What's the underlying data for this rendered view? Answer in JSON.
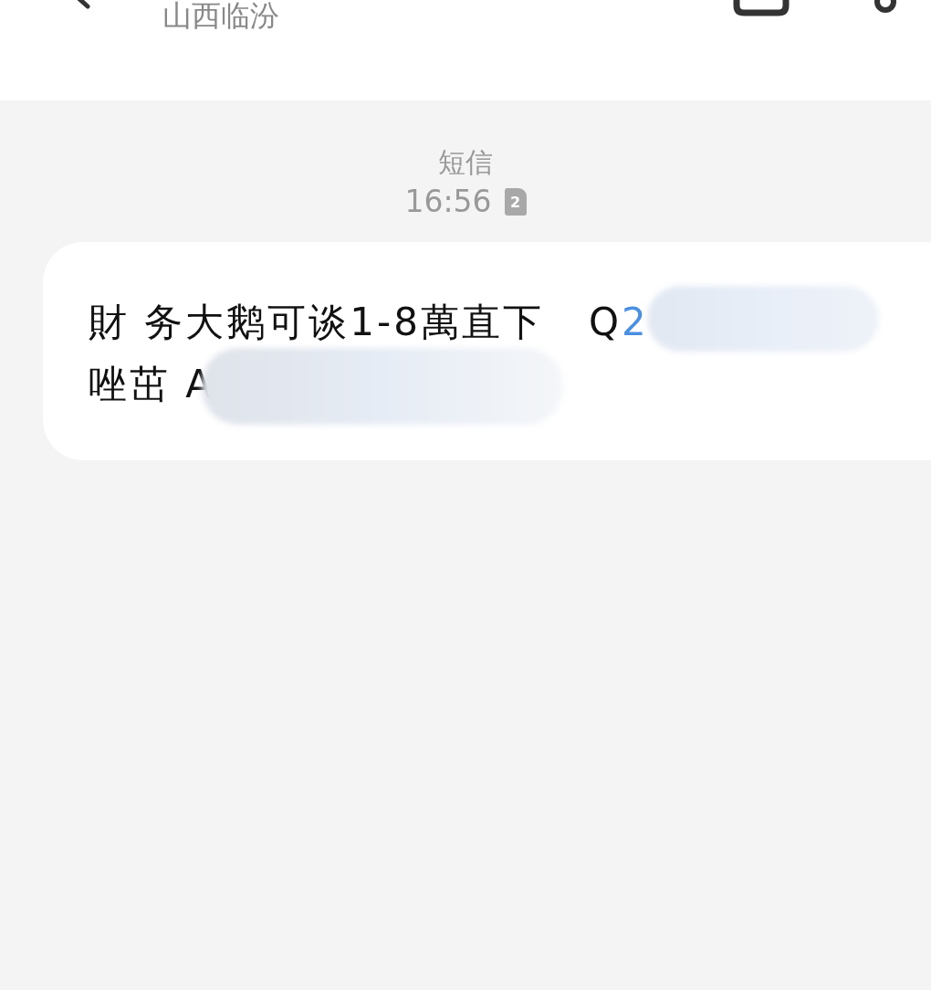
{
  "header": {
    "subtitle": "山西临汾"
  },
  "thread": {
    "channel": "短信",
    "time": "16:56",
    "sim": "2"
  },
  "message": {
    "line_1": "財 务大鹅可谈1-8萬直下   Q",
    "link": "2",
    "line_2": "唑茁 A"
  }
}
